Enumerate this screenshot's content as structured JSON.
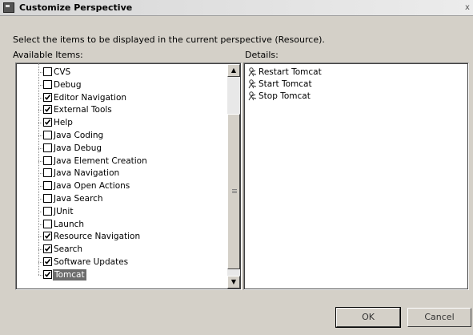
{
  "window": {
    "title": "Customize Perspective",
    "close_glyph": "x"
  },
  "instruction": "Select the items to be displayed in the current perspective (Resource).",
  "available_label": "Available Items:",
  "details_label": "Details:",
  "items": [
    {
      "label": "CVS",
      "checked": false,
      "selected": false
    },
    {
      "label": "Debug",
      "checked": false,
      "selected": false
    },
    {
      "label": "Editor Navigation",
      "checked": true,
      "selected": false
    },
    {
      "label": "External Tools",
      "checked": true,
      "selected": false
    },
    {
      "label": "Help",
      "checked": true,
      "selected": false
    },
    {
      "label": "Java Coding",
      "checked": false,
      "selected": false
    },
    {
      "label": "Java Debug",
      "checked": false,
      "selected": false
    },
    {
      "label": "Java Element Creation",
      "checked": false,
      "selected": false
    },
    {
      "label": "Java Navigation",
      "checked": false,
      "selected": false
    },
    {
      "label": "Java Open Actions",
      "checked": false,
      "selected": false
    },
    {
      "label": "Java Search",
      "checked": false,
      "selected": false
    },
    {
      "label": "JUnit",
      "checked": false,
      "selected": false
    },
    {
      "label": "Launch",
      "checked": false,
      "selected": false
    },
    {
      "label": "Resource Navigation",
      "checked": true,
      "selected": false
    },
    {
      "label": "Search",
      "checked": true,
      "selected": false
    },
    {
      "label": "Software Updates",
      "checked": true,
      "selected": false
    },
    {
      "label": "Tomcat",
      "checked": true,
      "selected": true
    }
  ],
  "details": [
    {
      "label": "Restart Tomcat",
      "icon": "tomcat-action-icon"
    },
    {
      "label": "Start Tomcat",
      "icon": "tomcat-action-icon"
    },
    {
      "label": "Stop Tomcat",
      "icon": "tomcat-action-icon"
    }
  ],
  "buttons": {
    "ok": "OK",
    "cancel": "Cancel"
  },
  "colors": {
    "dialog_bg": "#d4d0c8",
    "selection_bg": "#6c6c6c"
  }
}
